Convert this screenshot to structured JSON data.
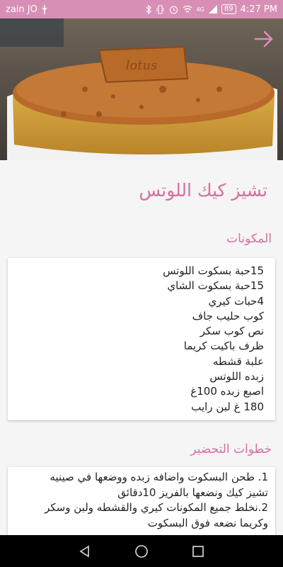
{
  "status_bar": {
    "carrier": "zain JO",
    "network": "4G",
    "battery": "89",
    "time": "4:27 PM"
  },
  "recipe": {
    "title": "تشيز كيك اللوتس"
  },
  "ingredients": {
    "label": "المكونات",
    "items": [
      "15حبة بسكوت اللوتس",
      "15حبة بسكوت الشاي",
      "4حبات كيري",
      "كوب حليب جاف",
      "نص كوب سكر",
      "ظرف باكيت كريما",
      "علبة قشطه",
      "زبده اللوتس",
      "اصبع زبده 100غ",
      "180 غ لبن رايب"
    ]
  },
  "steps": {
    "label": "خطوات التحضير",
    "lines": [
      "1. طحن البسكوت واضافه زبده ووضعها في صينيه",
      "تشيز كيك ونضعها بالفريز 10دقائق",
      "2.نخلط جميع المكونات كيري والقشطه ولبن وسكر",
      "وكريما نضعه فوق البسكوت"
    ]
  },
  "icons": {
    "back": "arrow-right-icon",
    "nav_back": "triangle-back-icon",
    "nav_home": "circle-home-icon",
    "nav_recents": "square-recents-icon"
  },
  "colors": {
    "accent": "#d86ea1",
    "status_bar": "#d88fb5"
  }
}
